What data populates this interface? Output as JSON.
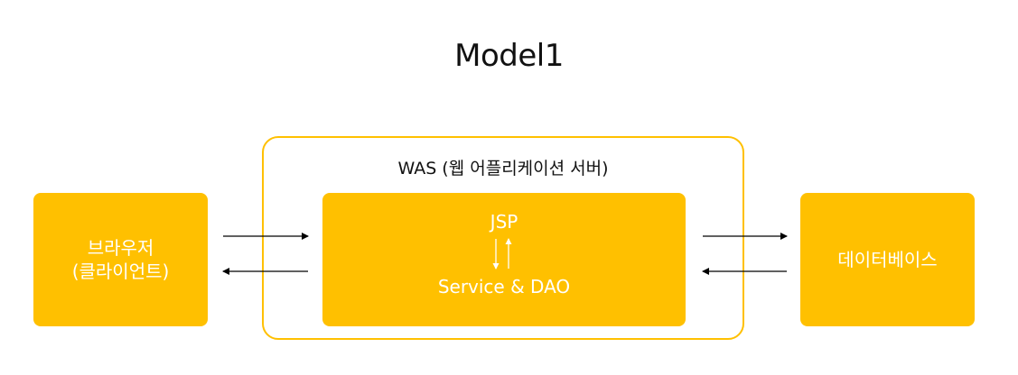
{
  "title": "Model1",
  "browser": {
    "line1": "브라우저",
    "line2": "(클라이언트)"
  },
  "was": {
    "title": "WAS (웹 어플리케이션 서버)"
  },
  "inner": {
    "top": "JSP",
    "bottom": "Service & DAO"
  },
  "database": {
    "label": "데이터베이스"
  },
  "colors": {
    "box": "#FFC000",
    "box_text": "#FFFFFF",
    "arrow": "#000000"
  }
}
